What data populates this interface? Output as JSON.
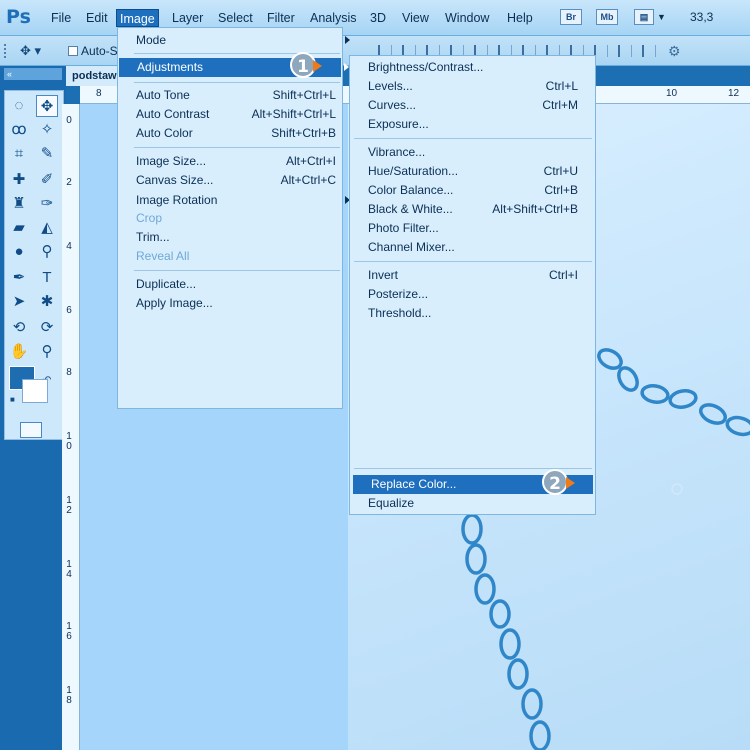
{
  "app": {
    "logo": "Ps"
  },
  "menubar": {
    "items": [
      "File",
      "Edit",
      "Image",
      "Layer",
      "Select",
      "Filter",
      "Analysis",
      "3D",
      "View",
      "Window",
      "Help"
    ],
    "icons": [
      {
        "name": "bridge-icon",
        "label": "Br"
      },
      {
        "name": "minibridge-icon",
        "label": "Mb"
      }
    ],
    "zoom": "33,3"
  },
  "options": {
    "autoselect_label": "Auto-Se"
  },
  "document": {
    "tab_label": "podstaw"
  },
  "rulers": {
    "top": [
      "8",
      "10",
      "12"
    ],
    "left": [
      "0",
      "2",
      "4",
      "6",
      "8",
      "10",
      "12",
      "14",
      "16",
      "18"
    ]
  },
  "image_menu": {
    "items": [
      {
        "label": "Mode",
        "shortcut": "",
        "submenu": true,
        "disabled": false
      },
      {
        "label": "Adjustments",
        "shortcut": "",
        "submenu": true,
        "disabled": false,
        "highlighted": true
      },
      {
        "label": "Auto Tone",
        "shortcut": "Shift+Ctrl+L",
        "disabled": false
      },
      {
        "label": "Auto Contrast",
        "shortcut": "Alt+Shift+Ctrl+L",
        "disabled": false
      },
      {
        "label": "Auto Color",
        "shortcut": "Shift+Ctrl+B",
        "disabled": false
      },
      {
        "label": "Image Size...",
        "shortcut": "Alt+Ctrl+I",
        "disabled": false
      },
      {
        "label": "Canvas Size...",
        "shortcut": "Alt+Ctrl+C",
        "disabled": false
      },
      {
        "label": "Image Rotation",
        "shortcut": "",
        "submenu": true,
        "disabled": false
      },
      {
        "label": "Crop",
        "shortcut": "",
        "disabled": true
      },
      {
        "label": "Trim...",
        "shortcut": "",
        "disabled": false
      },
      {
        "label": "Reveal All",
        "shortcut": "",
        "disabled": true
      },
      {
        "label": "Duplicate...",
        "shortcut": "",
        "disabled": false
      },
      {
        "label": "Apply Image...",
        "shortcut": "",
        "disabled": false
      }
    ]
  },
  "adjustments_menu": {
    "items": [
      {
        "label": "Brightness/Contrast...",
        "shortcut": ""
      },
      {
        "label": "Levels...",
        "shortcut": "Ctrl+L"
      },
      {
        "label": "Curves...",
        "shortcut": "Ctrl+M"
      },
      {
        "label": "Exposure...",
        "shortcut": ""
      },
      {
        "label": "Vibrance...",
        "shortcut": ""
      },
      {
        "label": "Hue/Saturation...",
        "shortcut": "Ctrl+U"
      },
      {
        "label": "Color Balance...",
        "shortcut": "Ctrl+B"
      },
      {
        "label": "Black & White...",
        "shortcut": "Alt+Shift+Ctrl+B"
      },
      {
        "label": "Photo Filter...",
        "shortcut": ""
      },
      {
        "label": "Channel Mixer...",
        "shortcut": ""
      },
      {
        "label": "Invert",
        "shortcut": "Ctrl+I"
      },
      {
        "label": "Posterize...",
        "shortcut": ""
      },
      {
        "label": "Threshold...",
        "shortcut": ""
      },
      {
        "label": "Replace Color...",
        "shortcut": "",
        "highlighted": true
      },
      {
        "label": "Equalize",
        "shortcut": ""
      }
    ]
  },
  "callouts": [
    "1",
    "2"
  ],
  "colors": {
    "accent": "#1e6fbd",
    "foreground": "#1f6db1",
    "background": "#ffffff",
    "callout_arrow": "#f07a18"
  }
}
